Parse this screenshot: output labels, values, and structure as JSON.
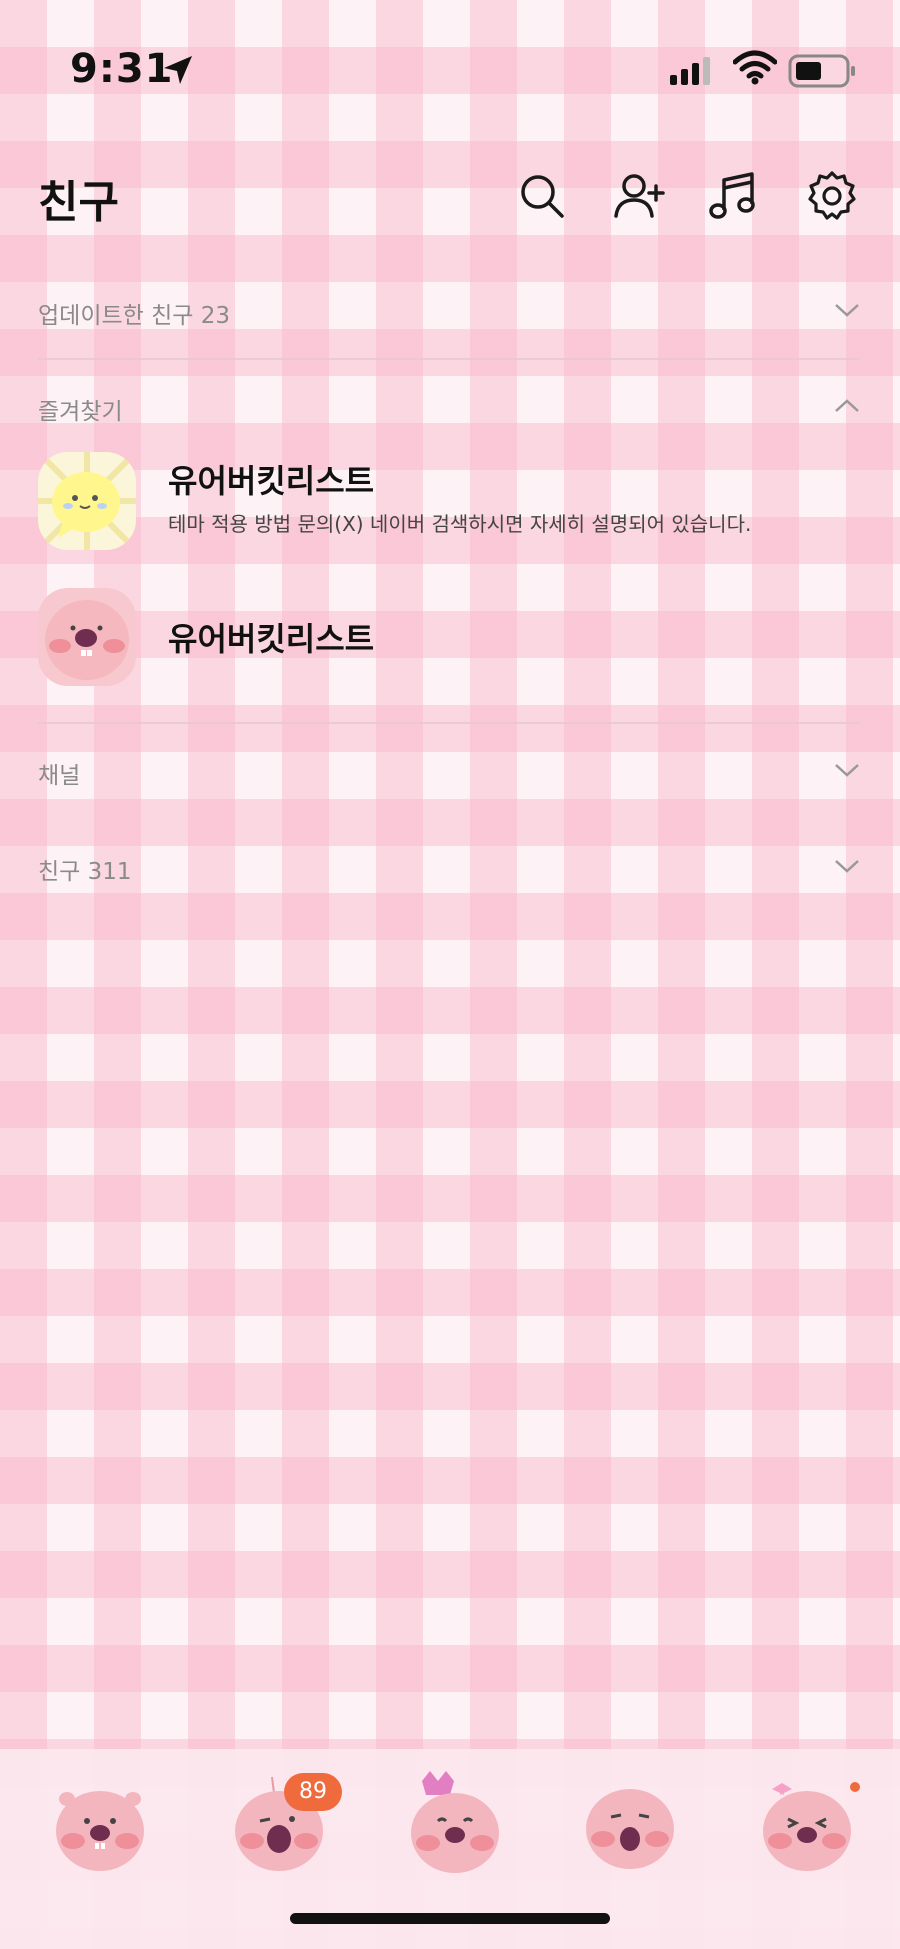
{
  "status_bar": {
    "time": "9:31"
  },
  "header": {
    "title": "친구",
    "icons": [
      "search-icon",
      "add-friend-icon",
      "music-icon",
      "settings-icon"
    ]
  },
  "sections": {
    "updated": {
      "label": "업데이트한 친구 23",
      "state": "collapsed"
    },
    "favorites": {
      "label": "즐겨찾기",
      "state": "expanded"
    },
    "channel": {
      "label": "채널",
      "state": "collapsed"
    },
    "friends": {
      "label": "친구 311",
      "state": "collapsed"
    }
  },
  "favorites_list": [
    {
      "name": "유어버킷리스트",
      "status": "테마 적용 방법 문의(X) 네이버 검색하시면 자세히 설명되어 있습니다."
    },
    {
      "name": "유어버킷리스트",
      "status": ""
    }
  ],
  "tabbar": {
    "tabs": [
      "friends-tab-icon",
      "chats-tab-icon",
      "view-tab-icon",
      "shopping-tab-icon",
      "more-tab-icon"
    ],
    "chat_badge": "89"
  },
  "colors": {
    "badge": "#ef6a3d",
    "gingham": "#f7b2c6"
  }
}
